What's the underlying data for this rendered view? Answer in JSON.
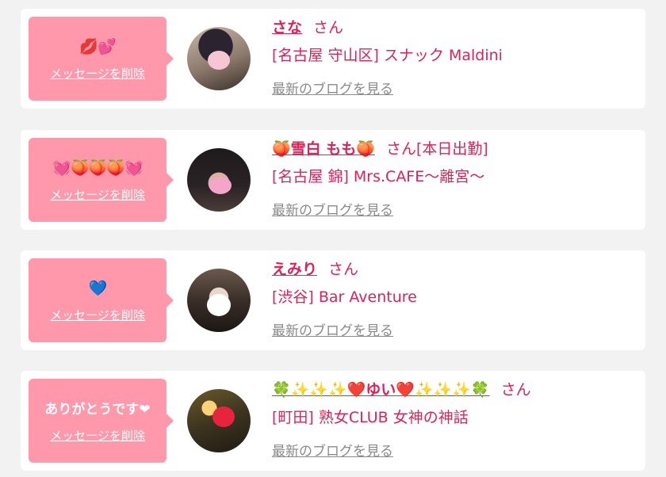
{
  "cards": [
    {
      "bubble_text": "💋💕",
      "delete_label": "メッセージを削除",
      "avatar": "avatar-photo",
      "name": "さな",
      "honorific": "さん",
      "status": "",
      "shop": "[名古屋 守山区] スナック Maldini",
      "blog_label": "最新のブログを見る"
    },
    {
      "bubble_text": "💓🍑🍑🍑💓",
      "delete_label": "メッセージを削除",
      "avatar": "avatar-photo",
      "name": "🍑雪白 もも🍑",
      "honorific": "さん",
      "status": "[本日出勤]",
      "shop": "[名古屋 錦] Mrs.CAFE～離宮～",
      "blog_label": "最新のブログを見る"
    },
    {
      "bubble_text": "💙",
      "delete_label": "メッセージを削除",
      "avatar": "avatar-photo",
      "name": "えみり",
      "honorific": "さん",
      "status": "",
      "shop": "[渋谷] Bar Aventure",
      "blog_label": "最新のブログを見る"
    },
    {
      "bubble_text": "ありがとうです❤",
      "delete_label": "メッセージを削除",
      "avatar": "avatar-photo",
      "name": "🍀✨✨✨❤️ゆい❤️✨✨✨🍀",
      "honorific": "さん",
      "status": "",
      "shop": "[町田] 熟女CLUB 女神の神話",
      "blog_label": "最新のブログを見る"
    }
  ],
  "colors": {
    "accent": "#e02059",
    "bubble": "#ff98ab",
    "link_gray": "#8a8a8a",
    "page_bg": "#f2f2f2"
  }
}
